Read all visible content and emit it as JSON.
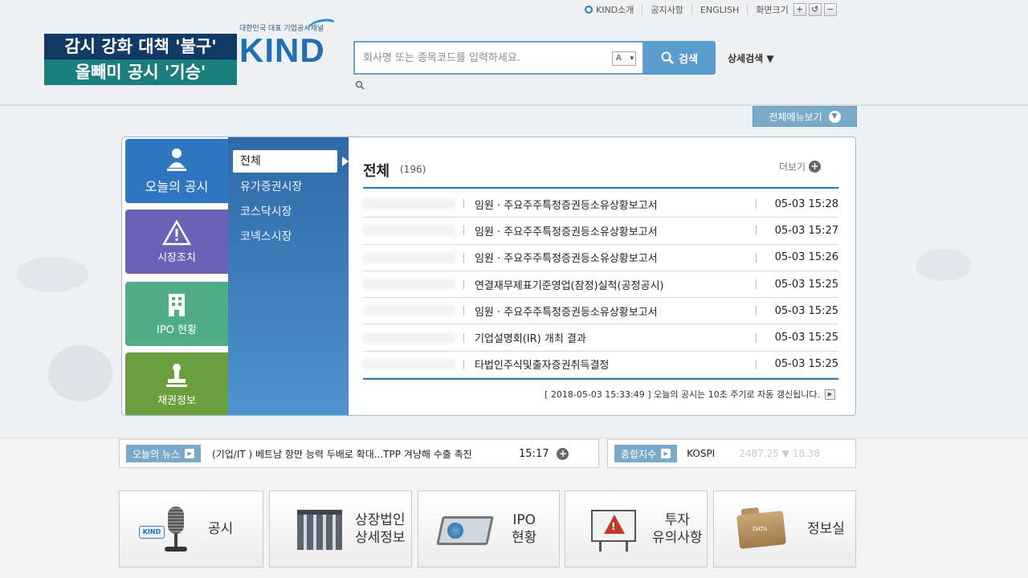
{
  "caption": {
    "line1": "감시 강화 대책 '불구'",
    "line2": "올빼미 공시 '기승'"
  },
  "util_nav": {
    "items": [
      "KIND소개",
      "공지사항",
      "ENGLISH",
      "화면크기"
    ],
    "zoom_in": "+",
    "zoom_reset": "↺",
    "zoom_out": "−"
  },
  "logo": {
    "tagline": "대한민국 대표 기업공시채널",
    "word": "KIND"
  },
  "search": {
    "placeholder": "회사명 또는 종목코드를 입력하세요.",
    "lang_option": "A",
    "button_label": "검색",
    "detail_label": "상세검색 ▼"
  },
  "full_menu": {
    "label": "전체메뉴보기"
  },
  "side_tabs": [
    {
      "label": "오늘의 공시",
      "icon": "person-icon"
    },
    {
      "label": "시장조치",
      "icon": "warning-icon"
    },
    {
      "label": "IPO 현황",
      "icon": "building-icon"
    },
    {
      "label": "채권정보",
      "icon": "stamp-icon"
    }
  ],
  "submenu": {
    "items": [
      "전체",
      "유가증권시장",
      "코스닥시장",
      "코넥스시장"
    ]
  },
  "list": {
    "title": "전체",
    "count": "(196)",
    "more_label": "더보기",
    "rows": [
      {
        "title": "임원 · 주요주주특정증권등소유상황보고서",
        "time": "05-03 15:28"
      },
      {
        "title": "임원 · 주요주주특정증권등소유상황보고서",
        "time": "05-03 15:27"
      },
      {
        "title": "임원 · 주요주주특정증권등소유상황보고서",
        "time": "05-03 15:26"
      },
      {
        "title": "연결재무제표기준영업(잠정)실적(공정공시)",
        "time": "05-03 15:25"
      },
      {
        "title": "임원 · 주요주주특정증권등소유상황보고서",
        "time": "05-03 15:25"
      },
      {
        "title": "기업설명회(IR) 개최 결과",
        "time": "05-03 15:25"
      },
      {
        "title": "타법인주식및출자증권취득결정",
        "time": "05-03 15:25"
      }
    ],
    "refresh_note": "[ 2018-05-03 15:33:49 ] 오늘의 공시는 10초 주기로 자동 갱신됩니다."
  },
  "news": {
    "label": "오늘의 뉴스",
    "headline": "(기업/IT ) 베트남 항만 능력 두배로 확대...TPP 겨냥해 수출 촉진",
    "time": "15:17"
  },
  "index": {
    "label": "종합지수",
    "name": "KOSPI",
    "value": "2487.25 ▼ 18.38"
  },
  "quick_links": [
    {
      "label": "공시",
      "icon": "microphone-icon"
    },
    {
      "label": "상장법인\n상세정보",
      "icon": "building-icon"
    },
    {
      "label": "IPO\n현황",
      "icon": "laptop-globe-icon"
    },
    {
      "label": "투자\n유의사항",
      "icon": "warning-board-icon"
    },
    {
      "label": "정보실",
      "icon": "folder-icon"
    }
  ],
  "colors": {
    "accent_blue": "#2f78c0",
    "tab_market": "#6a62b6",
    "tab_ipo": "#4fae87",
    "tab_bond": "#6b9e3e",
    "caption_navy": "#123a66",
    "caption_teal": "#1a7d7e"
  }
}
